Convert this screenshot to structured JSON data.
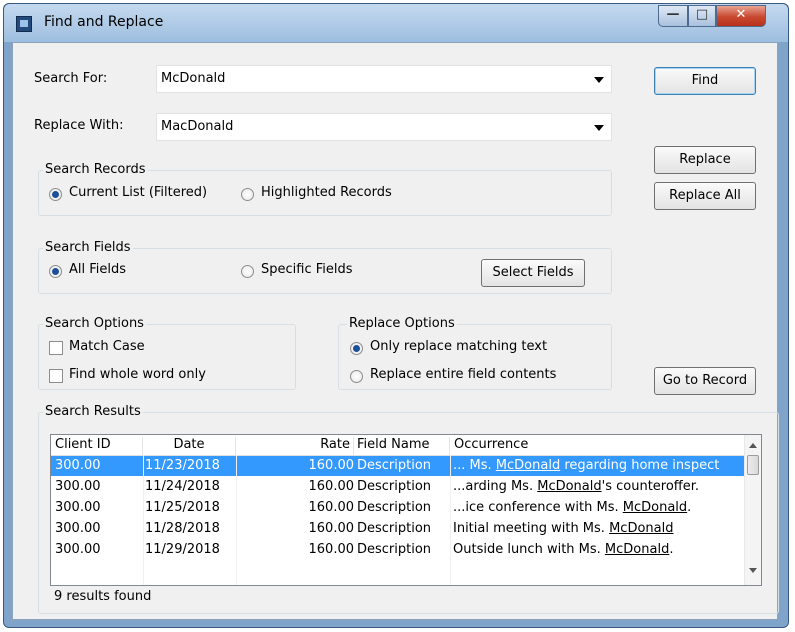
{
  "window": {
    "title": "Find and Replace",
    "controls": {
      "minimize": "—",
      "maximize": "□",
      "close": "✕"
    }
  },
  "search_for": {
    "label": "Search For:",
    "value": "McDonald"
  },
  "replace_with": {
    "label": "Replace With:",
    "value": "MacDonald"
  },
  "buttons": {
    "find": "Find",
    "replace": "Replace",
    "replace_all": "Replace All",
    "select_fields": "Select Fields",
    "go_to_record": "Go to Record"
  },
  "search_records": {
    "title": "Search Records",
    "options": [
      "Current List (Filtered)",
      "Highlighted Records"
    ],
    "selected": 0
  },
  "search_fields": {
    "title": "Search Fields",
    "options": [
      "All Fields",
      "Specific Fields"
    ],
    "selected": 0
  },
  "search_options": {
    "title": "Search Options",
    "match_case": {
      "label": "Match Case",
      "checked": false
    },
    "whole_word": {
      "label": "Find whole word only",
      "checked": false
    }
  },
  "replace_options": {
    "title": "Replace Options",
    "options": [
      "Only replace matching text",
      "Replace entire field contents"
    ],
    "selected": 0
  },
  "results": {
    "title": "Search Results",
    "columns": [
      "Client ID",
      "Date",
      "Rate",
      "Field Name",
      "Occurrence"
    ],
    "rows": [
      {
        "client_id": "300.00",
        "date": "11/23/2018",
        "rate": "160.00",
        "field": "Description",
        "occurrence": "... Ms. McDonald regarding home inspect",
        "selected": true
      },
      {
        "client_id": "300.00",
        "date": "11/24/2018",
        "rate": "160.00",
        "field": "Description",
        "occurrence": "...arding Ms. McDonald's counteroffer.",
        "selected": false
      },
      {
        "client_id": "300.00",
        "date": "11/25/2018",
        "rate": "160.00",
        "field": "Description",
        "occurrence": "...ice conference with Ms. McDonald.",
        "selected": false
      },
      {
        "client_id": "300.00",
        "date": "11/28/2018",
        "rate": "160.00",
        "field": "Description",
        "occurrence": "Initial meeting with Ms. McDonald",
        "selected": false
      },
      {
        "client_id": "300.00",
        "date": "11/29/2018",
        "rate": "160.00",
        "field": "Description",
        "occurrence": "Outside lunch with Ms. McDonald.",
        "selected": false
      }
    ],
    "status": "9 results found"
  },
  "colors": {
    "selection": "#3399ff",
    "window_frame": "#7fa3c9"
  }
}
